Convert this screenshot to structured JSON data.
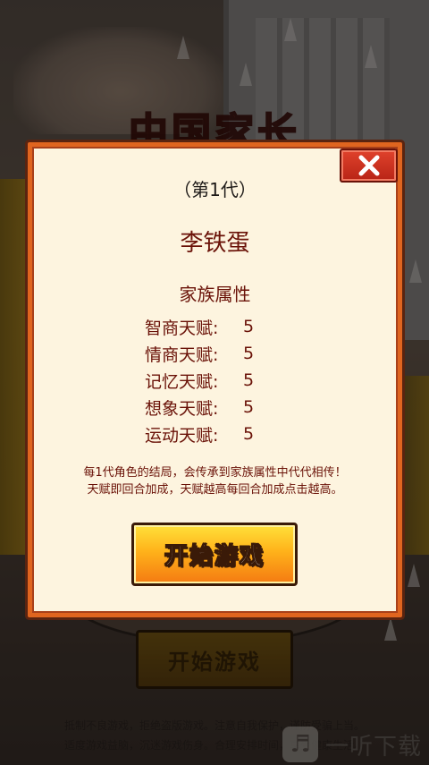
{
  "background": {
    "title": "中国家长",
    "start_label": "开始游戏",
    "notice_lines": [
      "抵制不良游戏，拒绝盗版游戏。注意自我保护，谨防受骗上当。",
      "适度游戏益脑，沉迷游戏伤身。合理安排时间，享受健康生活。"
    ],
    "watermark": "一听下载"
  },
  "dialog": {
    "generation": "（第1代）",
    "character_name": "李铁蛋",
    "attributes_title": "家族属性",
    "attributes": [
      {
        "label": "智商天赋:",
        "value": "5"
      },
      {
        "label": "情商天赋:",
        "value": "5"
      },
      {
        "label": "记忆天赋:",
        "value": "5"
      },
      {
        "label": "想象天赋:",
        "value": "5"
      },
      {
        "label": "运动天赋:",
        "value": "5"
      }
    ],
    "description_lines": [
      "每1代角色的结局，会传承到家族属性中代代相传！",
      "天赋即回合加成，天赋越高每回合加成点击越高。"
    ],
    "start_button": "开始游戏",
    "close_icon": "close-icon"
  },
  "colors": {
    "dialog_bg": "#fdf4df",
    "dialog_border": "#e0651f",
    "accent_text": "#6a1208",
    "close_red": "#c8301e",
    "button_yellow": "#ffc21f"
  }
}
